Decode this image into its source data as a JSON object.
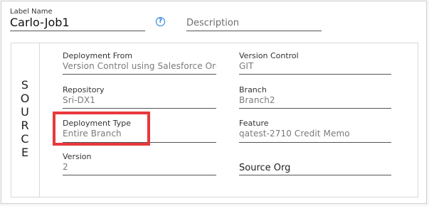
{
  "header": {
    "label_name_caption": "Label Name",
    "label_name_value": "Carlo-Job1",
    "help_glyph": "?",
    "description_placeholder": "Description"
  },
  "section": {
    "title_letters": [
      "S",
      "O",
      "U",
      "R",
      "C",
      "E"
    ],
    "fields": {
      "deployment_from": {
        "label": "Deployment From",
        "value": "Version Control using Salesforce Org"
      },
      "version_control": {
        "label": "Version Control",
        "value": "GIT"
      },
      "repository": {
        "label": "Repository",
        "value": "Sri-DX1"
      },
      "branch": {
        "label": "Branch",
        "value": "Branch2"
      },
      "deployment_type": {
        "label": "Deployment Type",
        "value": "Entire Branch"
      },
      "feature": {
        "label": "Feature",
        "value": "qatest-2710 Credit Memo"
      },
      "version": {
        "label": "Version",
        "value": "2"
      },
      "source_org": {
        "label": "Source Org",
        "value": ""
      }
    }
  },
  "highlight": {
    "color": "#e8383d",
    "target": "deployment_type"
  }
}
